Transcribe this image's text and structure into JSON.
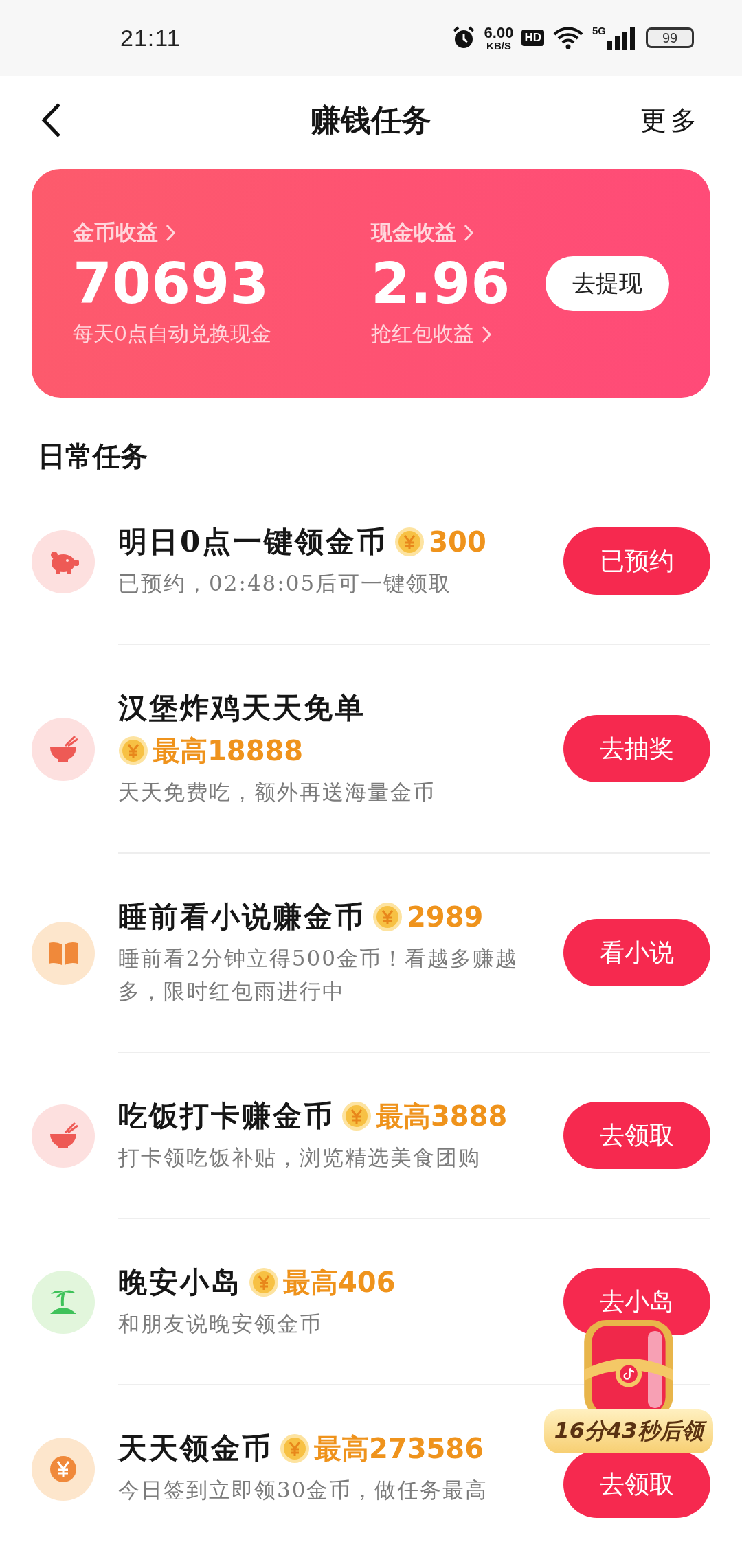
{
  "status_bar": {
    "time": "21:11",
    "speed": "6.00",
    "speed_unit": "KB/S",
    "hd": "HD",
    "network": "5G",
    "battery": "99"
  },
  "header": {
    "title": "赚钱任务",
    "more": "更多"
  },
  "earnings": {
    "coin_label": "金币收益",
    "coin_value": "70693",
    "coin_note": "每天0点自动兑换现金",
    "cash_label": "现金收益",
    "cash_value": "2.96",
    "cash_note": "抢红包收益",
    "withdraw": "去提现"
  },
  "section_title": "日常任务",
  "tasks": [
    {
      "kind": "piggy",
      "title": "明日0点一键领金币",
      "reward": "300",
      "desc": "已预约，02:48:05后可一键领取",
      "button": "已预约"
    },
    {
      "kind": "bowl",
      "title": "汉堡炸鸡天天免单",
      "reward": "最高18888",
      "desc": "天天免费吃，额外再送海量金币",
      "button": "去抽奖"
    },
    {
      "kind": "book",
      "title": "睡前看小说赚金币",
      "reward": "2989",
      "desc": "睡前看2分钟立得500金币！看越多赚越多，限时红包雨进行中",
      "button": "看小说"
    },
    {
      "kind": "bowl",
      "title": "吃饭打卡赚金币",
      "reward": "最高3888",
      "desc": "打卡领吃饭补贴，浏览精选美食团购",
      "button": "去领取"
    },
    {
      "kind": "island",
      "title": "晚安小岛",
      "reward": "最高406",
      "desc": "和朋友说晚安领金币",
      "button": "去小岛"
    },
    {
      "kind": "yen",
      "title": "天天领金币",
      "reward": "最高273586",
      "desc": "今日签到立即领30金币，做任务最高",
      "button": "去领取"
    }
  ],
  "treasure": {
    "countdown": "16分43秒后领"
  }
}
